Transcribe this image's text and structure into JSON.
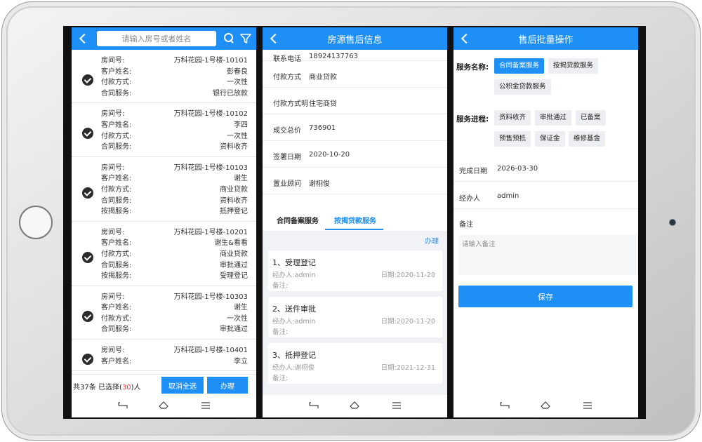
{
  "panel1": {
    "search_placeholder": "请输入房号或者姓名",
    "records": [
      {
        "fields": [
          {
            "k": "房间号:",
            "v": "万科花园-1号楼-10101"
          },
          {
            "k": "客户姓名:",
            "v": "彭春良"
          },
          {
            "k": "付款方式:",
            "v": "一次性"
          },
          {
            "k": "合同服务:",
            "v": "银行已放款"
          }
        ]
      },
      {
        "fields": [
          {
            "k": "房间号:",
            "v": "万科花园-1号楼-10102"
          },
          {
            "k": "客户姓名:",
            "v": "李四"
          },
          {
            "k": "付款方式:",
            "v": "一次性"
          },
          {
            "k": "合同服务:",
            "v": "资料收齐"
          }
        ]
      },
      {
        "fields": [
          {
            "k": "房间号:",
            "v": "万科花园-1号楼-10103"
          },
          {
            "k": "客户姓名:",
            "v": "谢生"
          },
          {
            "k": "付款方式:",
            "v": "商业贷款"
          },
          {
            "k": "合同服务:",
            "v": "资料收齐"
          },
          {
            "k": "按揭服务:",
            "v": "抵押登记"
          }
        ]
      },
      {
        "fields": [
          {
            "k": "房间号:",
            "v": "万科花园-1号楼-10201"
          },
          {
            "k": "客户姓名:",
            "v": "谢生&看看"
          },
          {
            "k": "付款方式:",
            "v": "商业贷款"
          },
          {
            "k": "合同服务:",
            "v": "审批通过"
          },
          {
            "k": "按揭服务:",
            "v": "受理登记"
          }
        ]
      },
      {
        "fields": [
          {
            "k": "房间号:",
            "v": "万科花园-1号楼-10303"
          },
          {
            "k": "客户姓名:",
            "v": "谢生"
          },
          {
            "k": "付款方式:",
            "v": "一次性"
          },
          {
            "k": "合同服务:",
            "v": "审批通过"
          }
        ]
      },
      {
        "fields": [
          {
            "k": "房间号:",
            "v": "万科花园-1号楼-10401"
          },
          {
            "k": "客户姓名:",
            "v": "李立"
          }
        ]
      }
    ],
    "total": "共37条",
    "selected_prefix": "已选择(",
    "selected_count": "30",
    "selected_suffix": ")人",
    "cancel_all_label": "取消全选",
    "process_label": "办理"
  },
  "panel2": {
    "title": "房源售后信息",
    "info": [
      {
        "k": "联系电话",
        "v": "18924137763"
      },
      {
        "k": "付款方式",
        "v": "商业贷款"
      },
      {
        "k": "付款方式明",
        "v": "住宅商贷"
      },
      {
        "k": "成交总价",
        "v": "736901"
      },
      {
        "k": "签署日期",
        "v": "2020-10-20"
      },
      {
        "k": "置业顾问",
        "v": "谢栩俊"
      }
    ],
    "tabs": [
      "合同备案服务",
      "按揭贷款服务"
    ],
    "active_tab": "按揭贷款服务",
    "action_link": "办理",
    "steps": [
      {
        "title": "1、受理登记",
        "operator": "经办人:admin",
        "date": "日期:2020-11-20",
        "note": "备注:"
      },
      {
        "title": "2、送件审批",
        "operator": "经办人:admin",
        "date": "日期:2020-11-20",
        "note": "备注:"
      },
      {
        "title": "3、抵押登记",
        "operator": "经办人:谢栩俊",
        "date": "日期:2021-12-31",
        "note": "备注:"
      }
    ]
  },
  "panel3": {
    "title": "售后批量操作",
    "service_name_label": "服务名称:",
    "service_chips": [
      "合同备案服务",
      "按揭贷款服务",
      "公积金贷款服务"
    ],
    "service_selected": "合同备案服务",
    "progress_label": "服务进程:",
    "progress_chips": [
      "资料收齐",
      "审批通过",
      "已备案",
      "预售预抵",
      "保证金",
      "维修基金"
    ],
    "completion_date_label": "完成日期",
    "completion_date_value": "2026-03-30",
    "handler_label": "经办人",
    "handler_value": "admin",
    "notes_label": "备注",
    "notes_placeholder": "请输入备注",
    "save_label": "保存"
  },
  "colors": {
    "accent": "#1e90f5",
    "selected_count": "#e53935"
  },
  "icons": [
    "back-arrow-icon",
    "search-icon",
    "filter-icon",
    "check-circle-icon",
    "nav-back-icon",
    "nav-home-icon",
    "nav-menu-icon"
  ]
}
